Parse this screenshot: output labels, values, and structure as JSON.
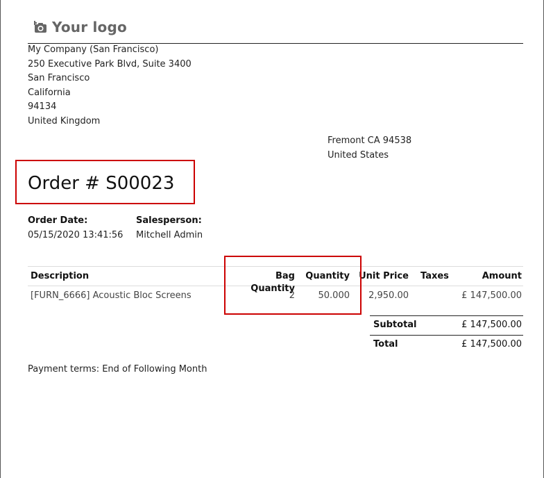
{
  "logo": {
    "text": "Your logo",
    "icon": "camera-icon"
  },
  "company": {
    "lines": [
      "My Company (San Francisco)",
      "250 Executive Park Blvd, Suite 3400",
      "San Francisco",
      "California",
      "94134",
      "United Kingdom"
    ]
  },
  "customer_address": {
    "lines": [
      "Fremont CA 94538",
      "United States"
    ]
  },
  "order": {
    "title": "Order # S00023"
  },
  "info": {
    "order_date_label": "Order Date:",
    "order_date_value": "05/15/2020 13:41:56",
    "salesperson_label": "Salesperson:",
    "salesperson_value": "Mitchell Admin"
  },
  "table": {
    "headers": {
      "description": "Description",
      "bag_quantity": "Bag Quantity",
      "quantity": "Quantity",
      "unit_price": "Unit Price",
      "taxes": "Taxes",
      "amount": "Amount"
    },
    "rows": [
      {
        "description": "[FURN_6666] Acoustic Bloc Screens",
        "bag_quantity": "2",
        "quantity": "50.000",
        "unit_price": "2,950.00",
        "taxes": "",
        "amount": "£ 147,500.00"
      }
    ]
  },
  "totals": {
    "subtotal_label": "Subtotal",
    "subtotal_value": "£ 147,500.00",
    "total_label": "Total",
    "total_value": "£ 147,500.00"
  },
  "payment_terms": "Payment terms: End of Following Month",
  "colors": {
    "highlight": "#cc0000",
    "logo": "#666666"
  }
}
